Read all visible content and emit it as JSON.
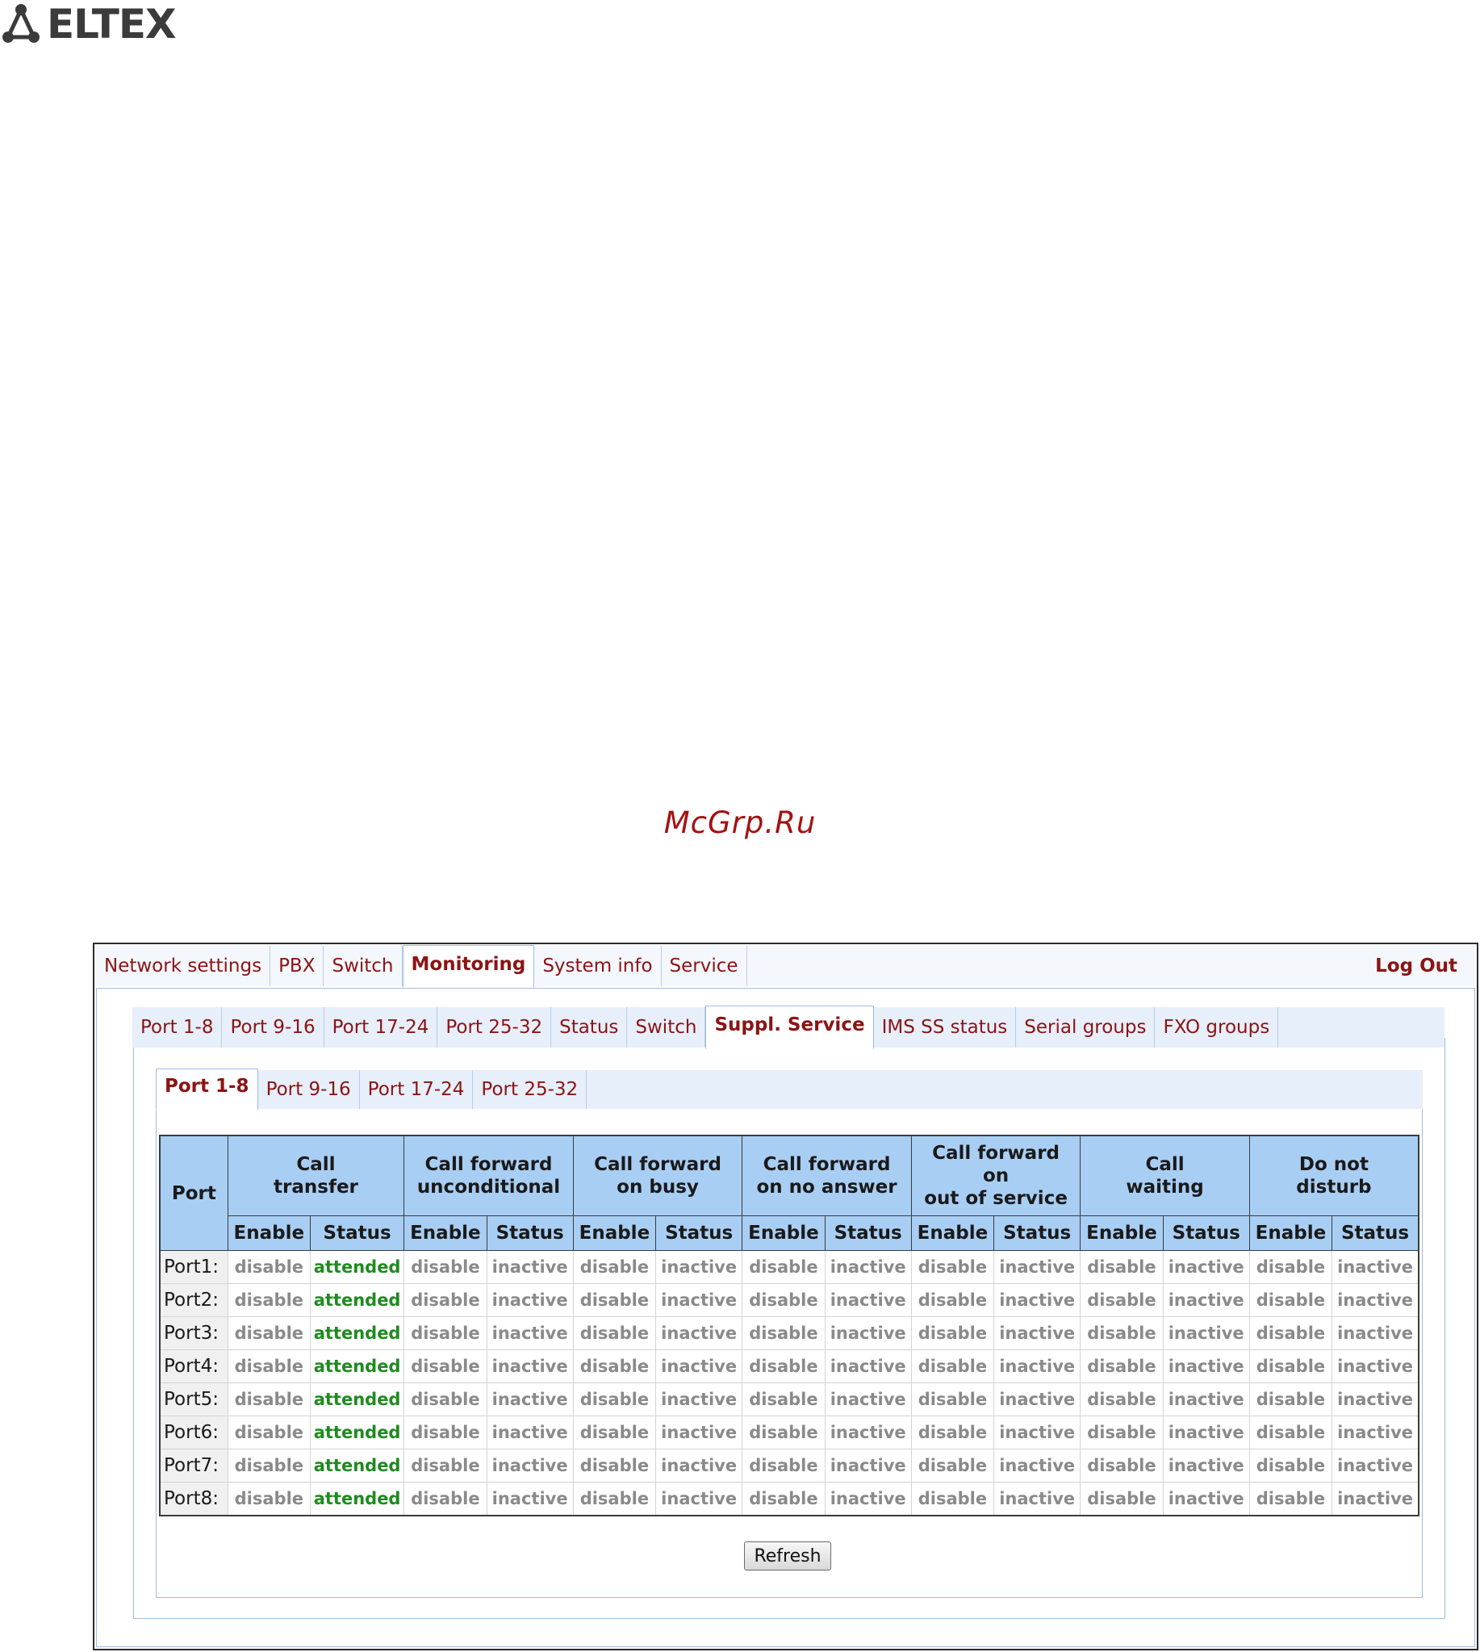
{
  "logo": {
    "text": "ELTEX"
  },
  "watermark": "McGrp.Ru",
  "main_tabs": [
    {
      "label": "Network settings",
      "active": false
    },
    {
      "label": "PBX",
      "active": false
    },
    {
      "label": "Switch",
      "active": false
    },
    {
      "label": "Monitoring",
      "active": true
    },
    {
      "label": "System info",
      "active": false
    },
    {
      "label": "Service",
      "active": false
    }
  ],
  "logout_label": "Log Out",
  "sub_tabs": [
    {
      "label": "Port 1-8",
      "active": false
    },
    {
      "label": "Port 9-16",
      "active": false
    },
    {
      "label": "Port 17-24",
      "active": false
    },
    {
      "label": "Port 25-32",
      "active": false
    },
    {
      "label": "Status",
      "active": false
    },
    {
      "label": "Switch",
      "active": false
    },
    {
      "label": "Suppl. Service",
      "active": true
    },
    {
      "label": "IMS SS status",
      "active": false
    },
    {
      "label": "Serial groups",
      "active": false
    },
    {
      "label": "FXO groups",
      "active": false
    }
  ],
  "port_tabs": [
    {
      "label": "Port 1-8",
      "active": true
    },
    {
      "label": "Port 9-16",
      "active": false
    },
    {
      "label": "Port 17-24",
      "active": false
    },
    {
      "label": "Port 25-32",
      "active": false
    }
  ],
  "table": {
    "port_header": "Port",
    "groups": [
      {
        "lines": [
          "Call",
          "transfer"
        ]
      },
      {
        "lines": [
          "Call forward",
          "unconditional"
        ]
      },
      {
        "lines": [
          "Call forward",
          "on busy"
        ]
      },
      {
        "lines": [
          "Call forward",
          "on no answer"
        ]
      },
      {
        "lines": [
          "Call forward",
          "on",
          "out of service"
        ]
      },
      {
        "lines": [
          "Call",
          "waiting"
        ]
      },
      {
        "lines": [
          "Do not",
          "disturb"
        ]
      }
    ],
    "sub_headers": [
      "Enable",
      "Status"
    ],
    "rows": [
      {
        "port": "Port1:",
        "cells": [
          "disable",
          "attended",
          "disable",
          "inactive",
          "disable",
          "inactive",
          "disable",
          "inactive",
          "disable",
          "inactive",
          "disable",
          "inactive",
          "disable",
          "inactive"
        ]
      },
      {
        "port": "Port2:",
        "cells": [
          "disable",
          "attended",
          "disable",
          "inactive",
          "disable",
          "inactive",
          "disable",
          "inactive",
          "disable",
          "inactive",
          "disable",
          "inactive",
          "disable",
          "inactive"
        ]
      },
      {
        "port": "Port3:",
        "cells": [
          "disable",
          "attended",
          "disable",
          "inactive",
          "disable",
          "inactive",
          "disable",
          "inactive",
          "disable",
          "inactive",
          "disable",
          "inactive",
          "disable",
          "inactive"
        ]
      },
      {
        "port": "Port4:",
        "cells": [
          "disable",
          "attended",
          "disable",
          "inactive",
          "disable",
          "inactive",
          "disable",
          "inactive",
          "disable",
          "inactive",
          "disable",
          "inactive",
          "disable",
          "inactive"
        ]
      },
      {
        "port": "Port5:",
        "cells": [
          "disable",
          "attended",
          "disable",
          "inactive",
          "disable",
          "inactive",
          "disable",
          "inactive",
          "disable",
          "inactive",
          "disable",
          "inactive",
          "disable",
          "inactive"
        ]
      },
      {
        "port": "Port6:",
        "cells": [
          "disable",
          "attended",
          "disable",
          "inactive",
          "disable",
          "inactive",
          "disable",
          "inactive",
          "disable",
          "inactive",
          "disable",
          "inactive",
          "disable",
          "inactive"
        ]
      },
      {
        "port": "Port7:",
        "cells": [
          "disable",
          "attended",
          "disable",
          "inactive",
          "disable",
          "inactive",
          "disable",
          "inactive",
          "disable",
          "inactive",
          "disable",
          "inactive",
          "disable",
          "inactive"
        ]
      },
      {
        "port": "Port8:",
        "cells": [
          "disable",
          "attended",
          "disable",
          "inactive",
          "disable",
          "inactive",
          "disable",
          "inactive",
          "disable",
          "inactive",
          "disable",
          "inactive",
          "disable",
          "inactive"
        ]
      }
    ]
  },
  "refresh_label": "Refresh",
  "colors": {
    "link": "#8b1414",
    "header_bg": "#a9cef4",
    "attended": "#1f8b1f",
    "inactive_text": "#8a8a8a",
    "tab_border": "#9fbde4"
  }
}
